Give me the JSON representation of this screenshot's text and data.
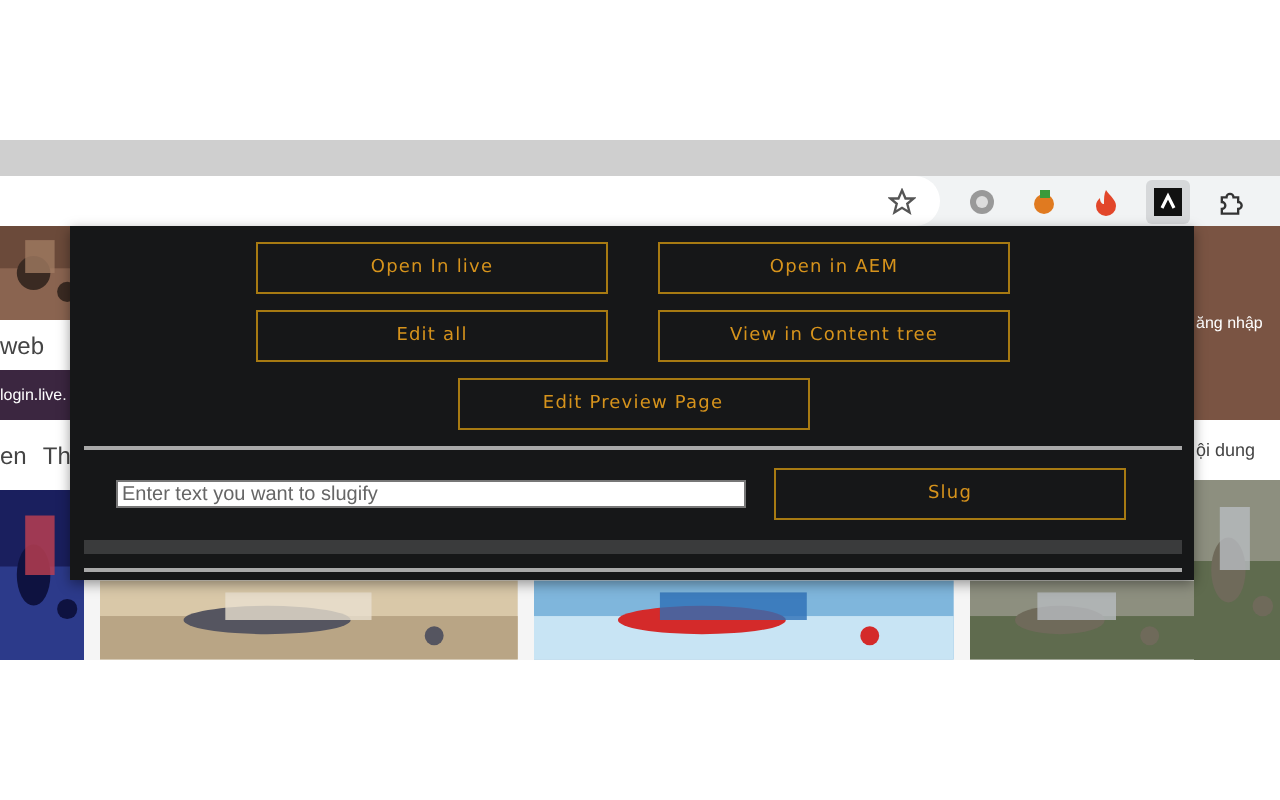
{
  "page_behind": {
    "left_column": {
      "search_text": "web",
      "link_text": "login.live.",
      "nav_items": [
        "en",
        "Th"
      ]
    },
    "right_column": {
      "login_text": "ăng nhập",
      "nav_text": "ội dung"
    }
  },
  "popup": {
    "button_rows": [
      [
        {
          "label": "Open In live"
        },
        {
          "label": "Open in AEM"
        }
      ],
      [
        {
          "label": "Edit all"
        },
        {
          "label": "View in Content tree"
        }
      ],
      [
        {
          "label": "Edit Preview Page"
        }
      ]
    ],
    "slug_input": {
      "placeholder": "Enter text you want to slugify"
    },
    "slug_button": {
      "label": "Slug"
    }
  }
}
